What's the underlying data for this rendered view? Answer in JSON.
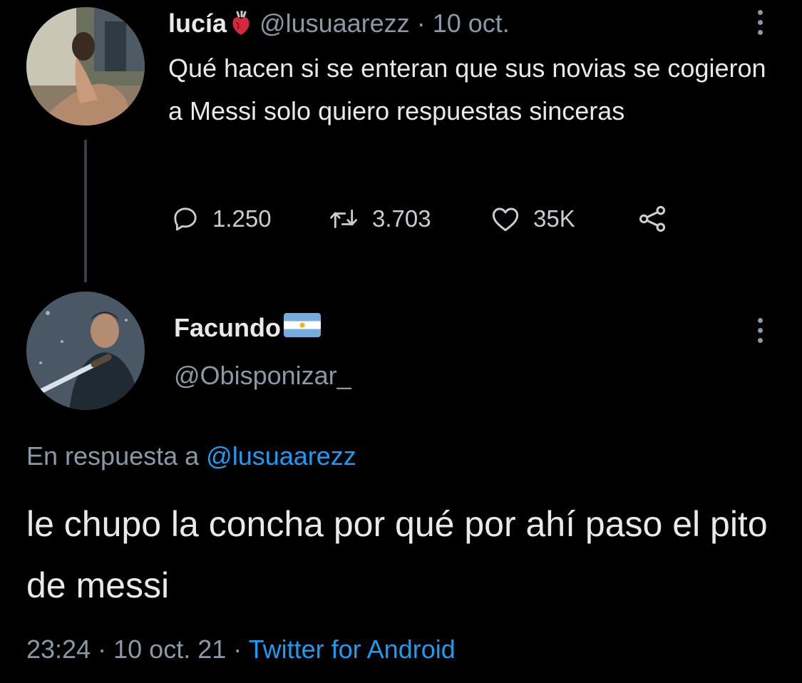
{
  "tweet1": {
    "display_name": "lucía",
    "name_emoji": "anatomical-heart-emoji",
    "handle": "@lusuaarezz",
    "separator": "·",
    "date": "10 oct.",
    "text": "Qué hacen si se enteran que sus novias se cogieron a Messi solo quiero respuestas sinceras",
    "replies": "1.250",
    "retweets": "3.703",
    "likes": "35K"
  },
  "tweet2": {
    "display_name": "Facundo",
    "name_emoji": "argentina-flag-emoji",
    "handle": "@Obisponizar_",
    "reply_prefix": "En respuesta a",
    "reply_to": "@lusuaarezz",
    "text": "le chupo la concha por qué por ahí paso el pito de messi",
    "time": "23:24",
    "separator": "·",
    "date": "10 oct. 21",
    "source": "Twitter for Android"
  },
  "colors": {
    "background": "#000000",
    "text": "#e7e9ea",
    "muted": "#8b98a5",
    "link": "#1d9bf0"
  }
}
